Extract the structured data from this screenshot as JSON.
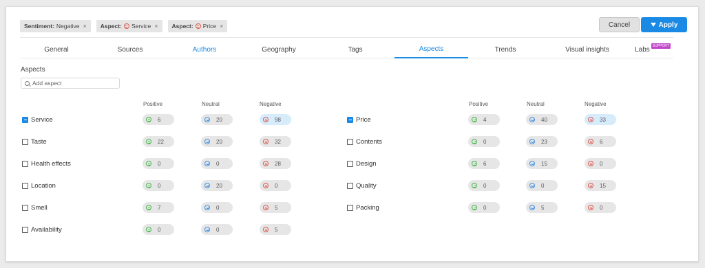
{
  "filters": [
    {
      "key": "Sentiment:",
      "value": "Negative",
      "icon": ""
    },
    {
      "key": "Aspect:",
      "value": "Service",
      "icon": "negative-face"
    },
    {
      "key": "Aspect:",
      "value": "Price",
      "icon": "negative-face"
    }
  ],
  "buttons": {
    "cancel": "Cancel",
    "apply": "Apply"
  },
  "tabs": [
    {
      "label": "General"
    },
    {
      "label": "Sources"
    },
    {
      "label": "Authors"
    },
    {
      "label": "Geography"
    },
    {
      "label": "Tags"
    },
    {
      "label": "Aspects"
    },
    {
      "label": "Trends"
    },
    {
      "label": "Visual insights"
    },
    {
      "label": "Labs",
      "badge": "SUPPORT"
    }
  ],
  "active_tab": "Aspects",
  "aspects_section": {
    "title": "Aspects",
    "search_placeholder": "Add aspect",
    "columns": [
      "Positive",
      "Neutral",
      "Negative"
    ]
  },
  "colors": {
    "accent": "#1a8ae4",
    "positive": "#43b54a",
    "neutral": "#3e8ee0",
    "negative": "#e0574f"
  },
  "left_aspects": [
    {
      "name": "Service",
      "checked": true,
      "positive": "6",
      "neutral": "20",
      "negative": "98",
      "negative_selected": true
    },
    {
      "name": "Taste",
      "checked": false,
      "positive": "22",
      "neutral": "20",
      "negative": "32"
    },
    {
      "name": "Health effects",
      "checked": false,
      "positive": "0",
      "neutral": "0",
      "negative": "28"
    },
    {
      "name": "Location",
      "checked": false,
      "positive": "0",
      "neutral": "20",
      "negative": "0"
    },
    {
      "name": "Smell",
      "checked": false,
      "positive": "7",
      "neutral": "0",
      "negative": "5"
    },
    {
      "name": "Availability",
      "checked": false,
      "positive": "0",
      "neutral": "0",
      "negative": "5"
    }
  ],
  "right_aspects": [
    {
      "name": "Price",
      "checked": true,
      "positive": "4",
      "neutral": "40",
      "negative": "33",
      "negative_selected": true
    },
    {
      "name": "Contents",
      "checked": false,
      "positive": "0",
      "neutral": "23",
      "negative": "6"
    },
    {
      "name": "Design",
      "checked": false,
      "positive": "6",
      "neutral": "15",
      "negative": "0"
    },
    {
      "name": "Quality",
      "checked": false,
      "positive": "0",
      "neutral": "0",
      "negative": "15"
    },
    {
      "name": "Packing",
      "checked": false,
      "positive": "0",
      "neutral": "5",
      "negative": "0"
    }
  ]
}
